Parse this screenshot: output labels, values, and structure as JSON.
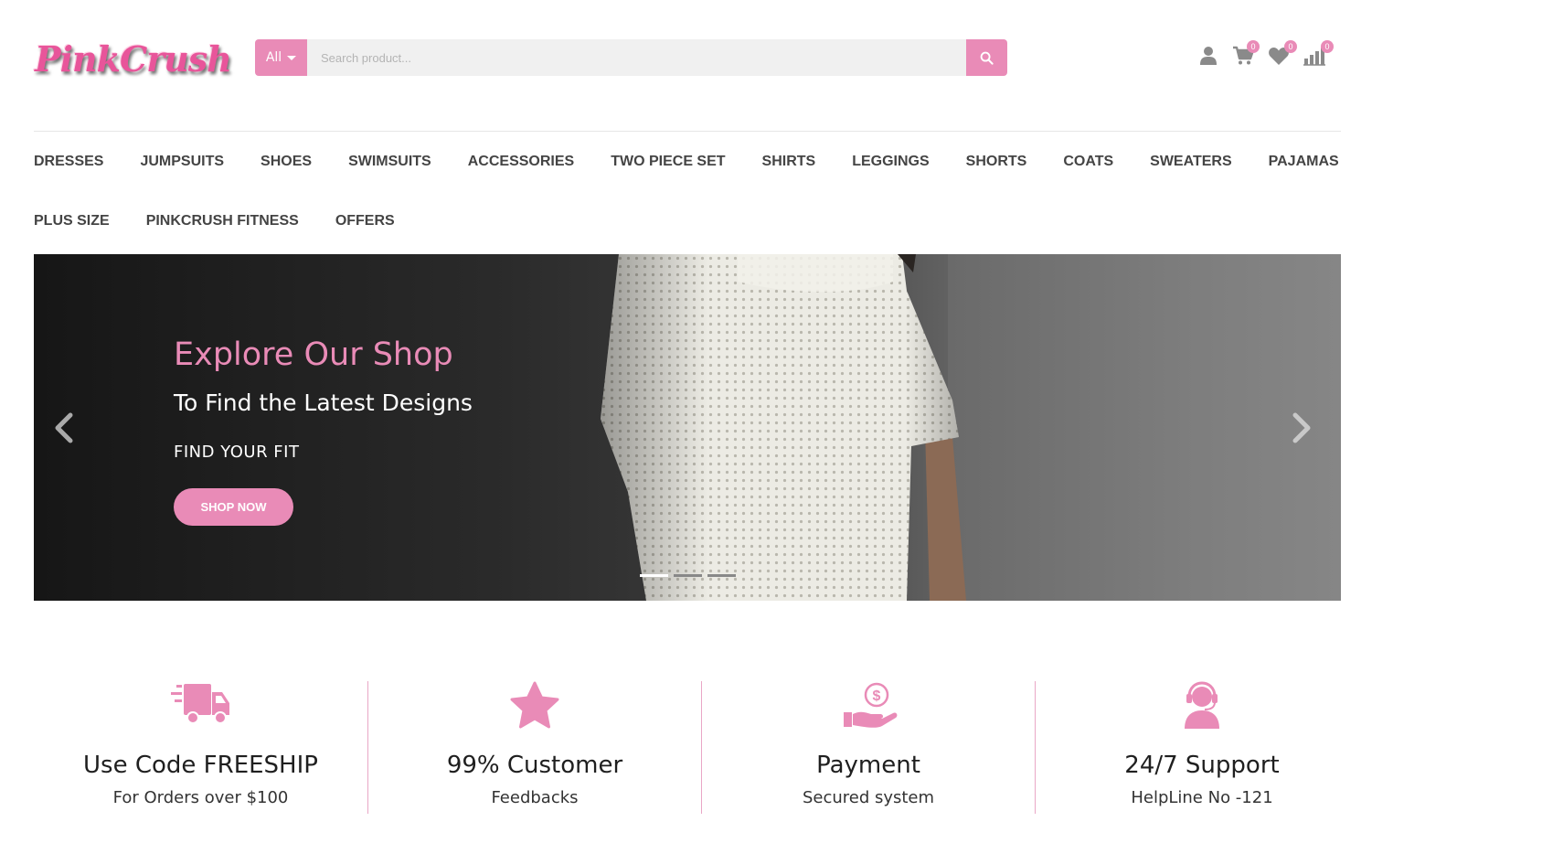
{
  "brand": {
    "logo_text": "PinkCrush",
    "accent": "#e98bb7"
  },
  "search": {
    "category": "All",
    "placeholder": "Search product...",
    "icon": "search-icon"
  },
  "header_icons": [
    {
      "name": "user-icon",
      "badge": ""
    },
    {
      "name": "cart-icon",
      "badge": "0"
    },
    {
      "name": "heart-icon",
      "badge": "0"
    },
    {
      "name": "compare-icon",
      "badge": "0"
    }
  ],
  "nav": {
    "row1": [
      "DRESSES",
      "JUMPSUITS",
      "SHOES",
      "SWIMSUITS",
      "ACCESSORIES",
      "TWO PIECE SET",
      "SHIRTS",
      "LEGGINGS",
      "SHORTS",
      "COATS",
      "SWEATERS",
      "PAJAMAS"
    ],
    "row2": [
      "PLUS SIZE",
      "PINKCRUSH FITNESS",
      "OFFERS"
    ]
  },
  "hero": {
    "title": "Explore Our Shop",
    "subtitle": "To Find the Latest Designs",
    "tagline": "FIND YOUR FIT",
    "button": "SHOP NOW",
    "slides": 3,
    "active_slide": 1
  },
  "features": [
    {
      "icon": "delivery-truck-icon",
      "title": "Use Code FREESHIP",
      "subtitle": "For Orders over $100"
    },
    {
      "icon": "star-icon",
      "title": "99% Customer",
      "subtitle": "Feedbacks"
    },
    {
      "icon": "payment-hand-icon",
      "title": "Payment",
      "subtitle": "Secured system"
    },
    {
      "icon": "support-headset-icon",
      "title": "24/7 Support",
      "subtitle": "HelpLine No -121"
    }
  ]
}
